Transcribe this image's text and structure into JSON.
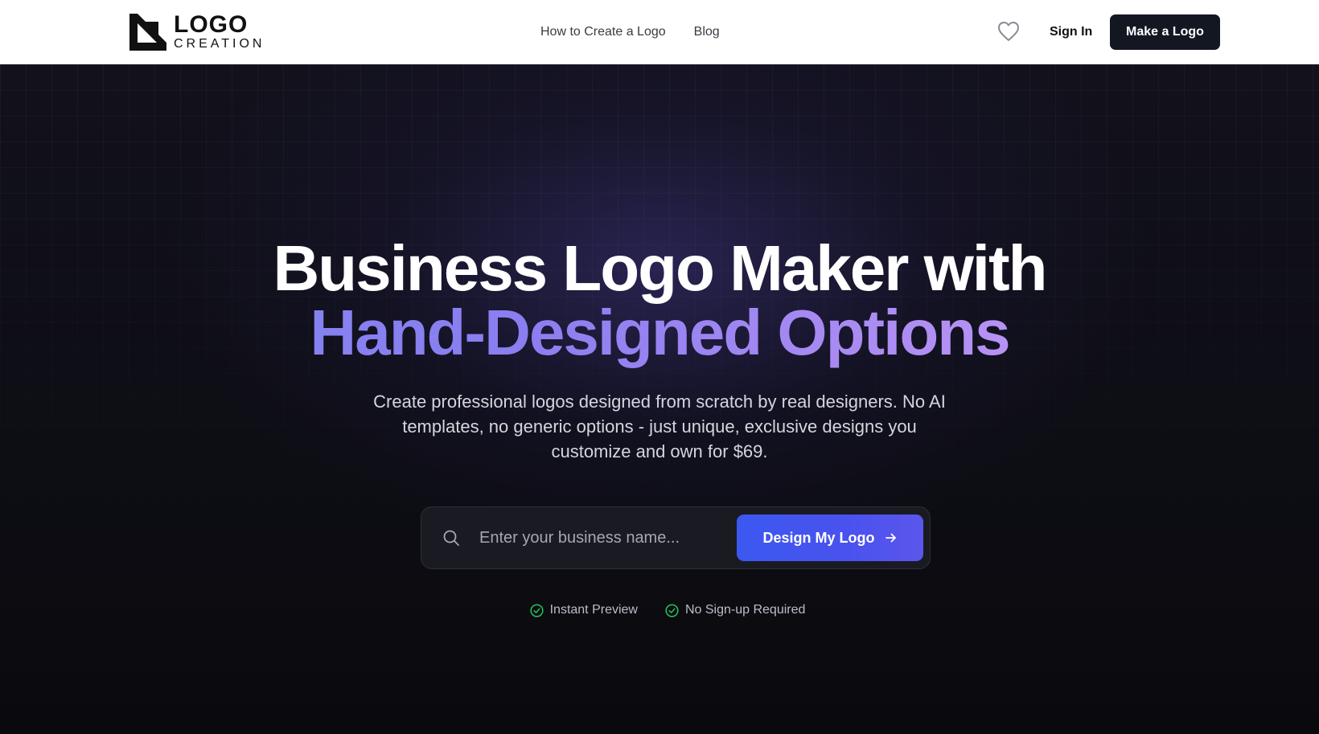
{
  "header": {
    "logo_word": "LOGO",
    "logo_sub": "CREATION",
    "nav": [
      {
        "label": "How to Create a Logo"
      },
      {
        "label": "Blog"
      }
    ],
    "icons": {
      "favorites": "heart-icon"
    },
    "sign_in": "Sign In",
    "cta": "Make a Logo"
  },
  "hero": {
    "title_line1": "Business Logo Maker with",
    "title_line2": "Hand-Designed Options",
    "subtitle": "Create professional logos designed from scratch by real designers. No AI templates, no generic options - just unique, exclusive designs you customize and own for $69.",
    "search": {
      "placeholder": "Enter your business name...",
      "value": "",
      "button": "Design My Logo"
    },
    "features": [
      {
        "label": "Instant Preview"
      },
      {
        "label": "No Sign-up Required"
      }
    ]
  },
  "colors": {
    "accent": "#4654ef",
    "gradient_text_start": "#7f86f2",
    "gradient_text_end": "#c9a2f6",
    "check": "#22c55e",
    "header_cta_bg": "#131722"
  }
}
